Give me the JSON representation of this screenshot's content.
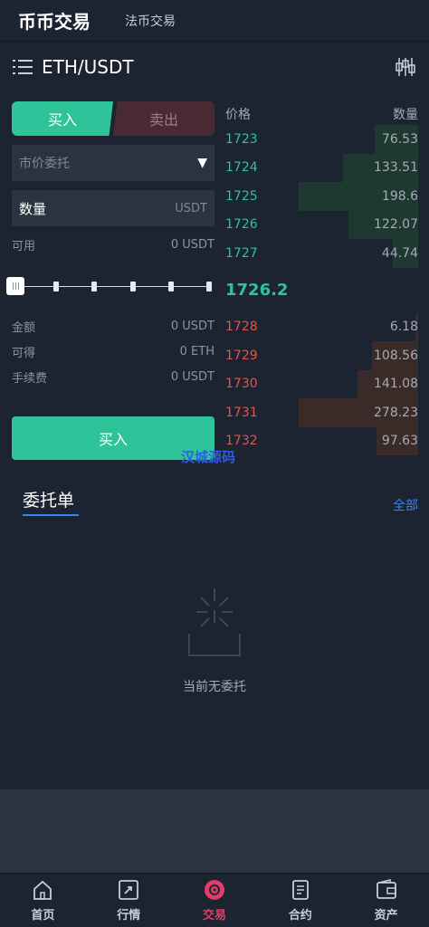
{
  "header": {
    "active_tab": "币币交易",
    "other_tab": "法币交易"
  },
  "pair": {
    "name": "ETH/USDT",
    "menu_icon": "menu-icon",
    "chart_icon": "chart-settings-icon"
  },
  "trade": {
    "buy_tab": "买入",
    "sell_tab": "卖出",
    "order_type": "市价委托",
    "qty_label": "数量",
    "qty_unit": "USDT",
    "available_label": "可用",
    "available_value": "0 USDT",
    "amount_label": "金额",
    "amount_value": "0 USDT",
    "receive_label": "可得",
    "receive_value": "0 ETH",
    "fee_label": "手续费",
    "fee_value": "0 USDT",
    "slider_level": 0,
    "submit_label": "买入"
  },
  "book": {
    "price_header": "价格",
    "qty_header": "数量",
    "bids": [
      {
        "price": "1723",
        "qty": "76.53",
        "depth": 0.36
      },
      {
        "price": "1724",
        "qty": "133.51",
        "depth": 0.63
      },
      {
        "price": "1725",
        "qty": "198.6",
        "depth": 1.0
      },
      {
        "price": "1726",
        "qty": "122.07",
        "depth": 0.58
      },
      {
        "price": "1727",
        "qty": "44.74",
        "depth": 0.21
      }
    ],
    "last_price": "1726.2",
    "asks": [
      {
        "price": "1728",
        "qty": "6.18",
        "depth": 0.02
      },
      {
        "price": "1729",
        "qty": "108.56",
        "depth": 0.39
      },
      {
        "price": "1730",
        "qty": "141.08",
        "depth": 0.51
      },
      {
        "price": "1731",
        "qty": "278.23",
        "depth": 1.0
      },
      {
        "price": "1732",
        "qty": "97.63",
        "depth": 0.35
      }
    ]
  },
  "watermark": "汉城源码",
  "orders": {
    "tab_label": "委托单",
    "all_label": "全部",
    "empty_text": "当前无委托"
  },
  "tabbar": [
    {
      "label": "首页",
      "icon": "home-icon"
    },
    {
      "label": "行情",
      "icon": "market-icon"
    },
    {
      "label": "交易",
      "icon": "trade-icon",
      "active": true
    },
    {
      "label": "合约",
      "icon": "contract-icon"
    },
    {
      "label": "资产",
      "icon": "wallet-icon"
    }
  ],
  "colors": {
    "buy": "#2fc39a",
    "sell": "#e5534b",
    "accent": "#3b82f6",
    "active_nav": "#e23c6b"
  }
}
